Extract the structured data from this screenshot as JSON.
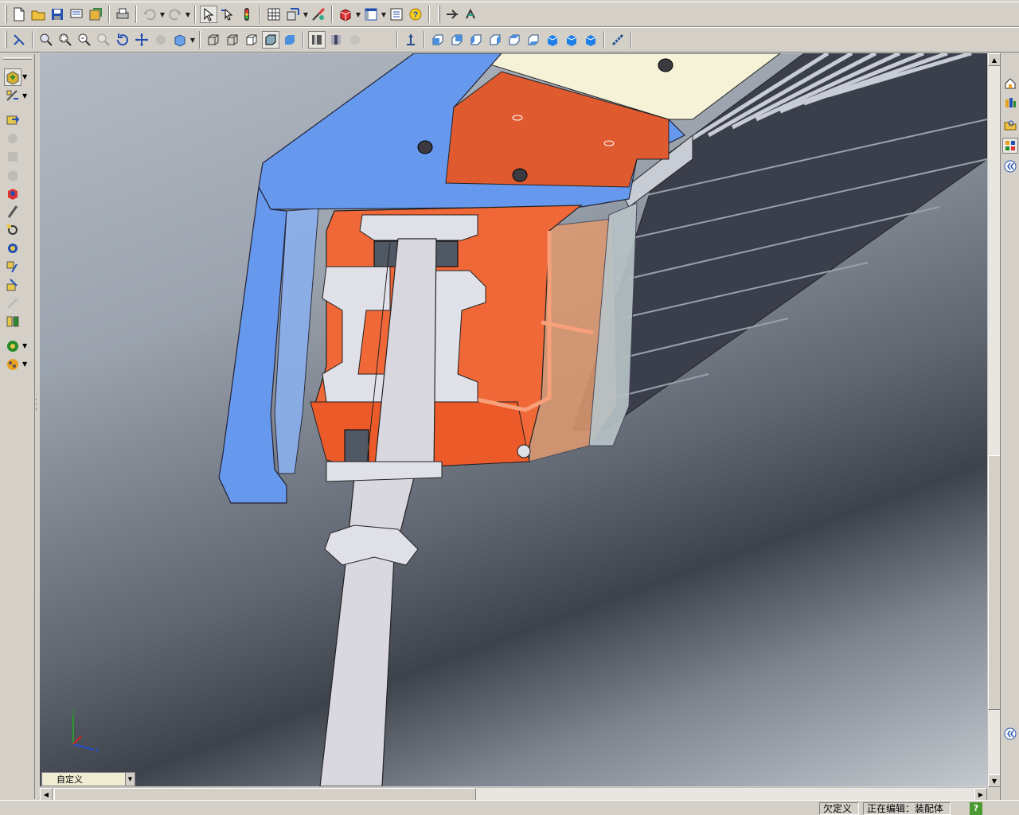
{
  "toolbar_top": {
    "icons": [
      "new-document",
      "open-folder",
      "save",
      "print-setup",
      "model-library",
      "print",
      "undo",
      "redo",
      "select-arrow",
      "select-smart",
      "rebuild",
      "grid",
      "dimension",
      "appearance",
      "3d-box",
      "view-window",
      "list",
      "help",
      "tools-a",
      "tools-b"
    ]
  },
  "toolbar_view": {
    "icons": [
      "previous-view",
      "zoom-fit",
      "zoom-area",
      "zoom-in-out",
      "zoom-selection",
      "rotate",
      "pan",
      "roll",
      "view-orientation",
      "wireframe",
      "hidden-lines",
      "hidden-removed",
      "shaded-edges",
      "shaded",
      "section-view",
      "perspective",
      "shadow",
      "normal-to",
      "front",
      "back",
      "left",
      "right",
      "top",
      "bottom",
      "isometric",
      "trimetric",
      "dimetric",
      "measure"
    ]
  },
  "left_toolbar": {
    "icons": [
      "insert-component",
      "mate",
      "move-component",
      "rotate-component",
      "smart-fasteners",
      "explode",
      "measure-tool",
      "interference",
      "clearance",
      "hole-series",
      "sketch-tools",
      "toolbox",
      "pattern",
      "assembly-features",
      "appearances",
      "photoworks"
    ]
  },
  "taskpane": {
    "icons": [
      "home",
      "design-library",
      "file-explorer",
      "view-palette",
      "collapse-chevrons",
      "expand-chevrons"
    ]
  },
  "view_selector": {
    "label": "自定义"
  },
  "statusbar": {
    "under_defined": "欠定义",
    "editing": "正在编辑：装配体",
    "help": "?"
  },
  "colors": {
    "blue_part": "#6699ee",
    "orange_part": "#e85a30",
    "cream_part": "#f5f2d8",
    "heatsink_dark": "#3b3f4c",
    "shaft_grey": "#d9d8e0"
  }
}
